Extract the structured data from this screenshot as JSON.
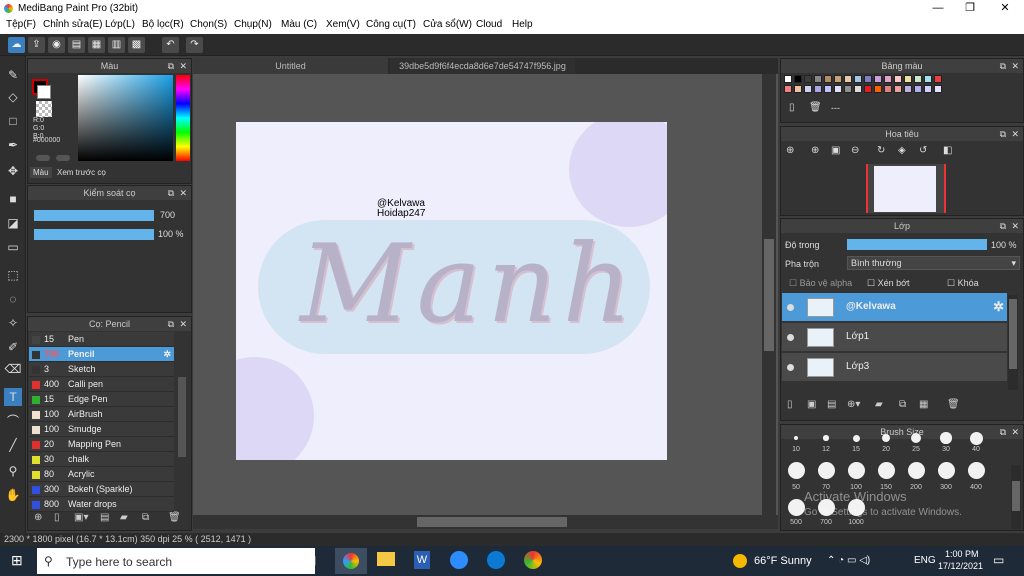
{
  "window": {
    "title": "MediBang Paint Pro (32bit)",
    "min": "—",
    "max": "❐",
    "close": "✕"
  },
  "menu": [
    "Tệp(F)",
    "Chỉnh sửa(E)",
    "Lớp(L)",
    "Bộ lọc(R)",
    "Chọn(S)",
    "Chụp(N)",
    "Màu (C)",
    "Xem(V)",
    "Công cụ(T)",
    "Cửa sổ(W)",
    "Cloud",
    "Help"
  ],
  "tabs": [
    "Untitled",
    "39dbe5d9f6f4ecda8d6e7de54747f956.jpg"
  ],
  "color_panel": {
    "title": "Màu",
    "r": "R:0",
    "g": "G:0",
    "b": "B:0",
    "hex": "#000000",
    "tab1": "Màu",
    "tab2": "Xem trước cọ"
  },
  "brush_ctrl": {
    "title": "Kiểm soát cọ",
    "size": "700",
    "opacity": "100 %"
  },
  "brush_list": {
    "title": "Cọ: Pencil",
    "items": [
      {
        "size": "15",
        "name": "Pen",
        "color": "#444444"
      },
      {
        "size": "700",
        "name": "Pencil",
        "color": "#333333"
      },
      {
        "size": "3",
        "name": "Sketch",
        "color": "#333333"
      },
      {
        "size": "400",
        "name": "Calli pen",
        "color": "#e03030"
      },
      {
        "size": "15",
        "name": "Edge Pen",
        "color": "#30b030"
      },
      {
        "size": "100",
        "name": "AirBrush",
        "color": "#f0e0d0"
      },
      {
        "size": "100",
        "name": "Smudge",
        "color": "#f0e0d0"
      },
      {
        "size": "20",
        "name": "Mapping Pen",
        "color": "#e03030"
      },
      {
        "size": "30",
        "name": "chalk",
        "color": "#e0e030"
      },
      {
        "size": "80",
        "name": "Acrylic",
        "color": "#e0e030"
      },
      {
        "size": "300",
        "name": "Bokeh (Sparkle)",
        "color": "#3050e0"
      },
      {
        "size": "800",
        "name": "Water drops",
        "color": "#3050e0"
      }
    ]
  },
  "canvas": {
    "watermark1": "@Kelvawa",
    "watermark2": "Hoidap247",
    "lettering": "Manh"
  },
  "palette": {
    "title": "Bảng màu",
    "dash": "---",
    "colors": [
      "#ffffff",
      "#000000",
      "#3c3c3c",
      "#888888",
      "#b48c64",
      "#c8a078",
      "#e8c8a8",
      "#a0c8e8",
      "#8080c0",
      "#c8a0e0",
      "#e0a0c8",
      "#ffc8c8",
      "#f0e0a0",
      "#c8e8c8",
      "#a0e0f0",
      "#e84040",
      "#f08080",
      "#f0c0a0",
      "#d0d0f0",
      "#a8a8e8",
      "#c0c0ff",
      "#e0e0ff",
      "#909090",
      "#dcdcdc",
      "#e02020",
      "#ff6000",
      "#e08080",
      "#f0a0a0",
      "#c0b0e0",
      "#b0b0f0",
      "#d0d0ff",
      "#e8e0ff"
    ]
  },
  "navigator": {
    "title": "Hoa tiêu"
  },
  "layers": {
    "title": "Lớp",
    "opacity_label": "Độ trong",
    "opacity_val": "100 %",
    "blend_label": "Pha trộn",
    "blend_val": "Bình thường",
    "alpha": "Bảo vệ alpha",
    "clip": "Xén bớt",
    "lock": "Khóa",
    "items": [
      {
        "name": "@Kelvawa",
        "selected": true
      },
      {
        "name": "Lớp1",
        "selected": false
      },
      {
        "name": "Lớp3",
        "selected": false
      }
    ]
  },
  "brush_size": {
    "title": "Brush Size",
    "row1": [
      "10",
      "12",
      "15",
      "20",
      "25",
      "30",
      "40"
    ],
    "row2": [
      "50",
      "70",
      "100",
      "150",
      "200",
      "300",
      "400"
    ],
    "row3": [
      "500",
      "700",
      "1000"
    ]
  },
  "activate": {
    "line1": "Activate Windows",
    "line2": "Go to Settings to activate Windows."
  },
  "status": "2300 * 1800 pixel   (16.7 * 13.1cm)   350 dpi   25 %   ( 2512, 1471 )",
  "taskbar": {
    "search": "Type here to search",
    "weather": "66°F  Sunny",
    "lang": "ENG",
    "time": "1:00 PM",
    "date": "17/12/2021"
  }
}
